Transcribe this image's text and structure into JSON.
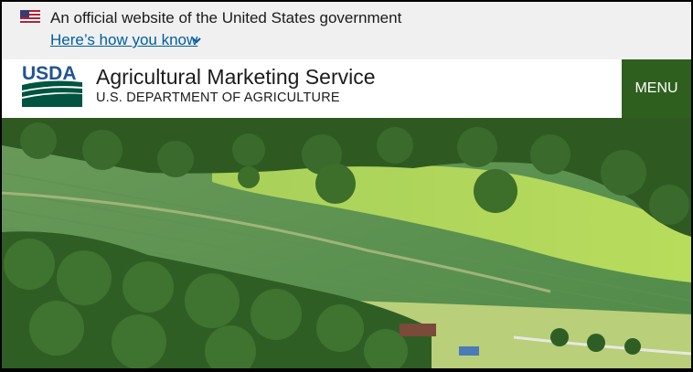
{
  "gov_banner": {
    "official_text": "An official website of the United States government",
    "how_link": "Here’s how you know"
  },
  "header": {
    "agency_name": "Agricultural Marketing Service",
    "department": "U.S. DEPARTMENT OF AGRICULTURE",
    "menu_label": "MENU",
    "logo_text": "USDA"
  },
  "colors": {
    "banner_bg": "#f0f0f0",
    "link": "#005ea2",
    "menu_bg": "#2e5f1f",
    "usda_green": "#005440",
    "usda_blue": "#205493"
  },
  "icons": {
    "flag": "us-flag-icon",
    "chevron": "chevron-down-icon"
  },
  "hero": {
    "description": ""
  }
}
